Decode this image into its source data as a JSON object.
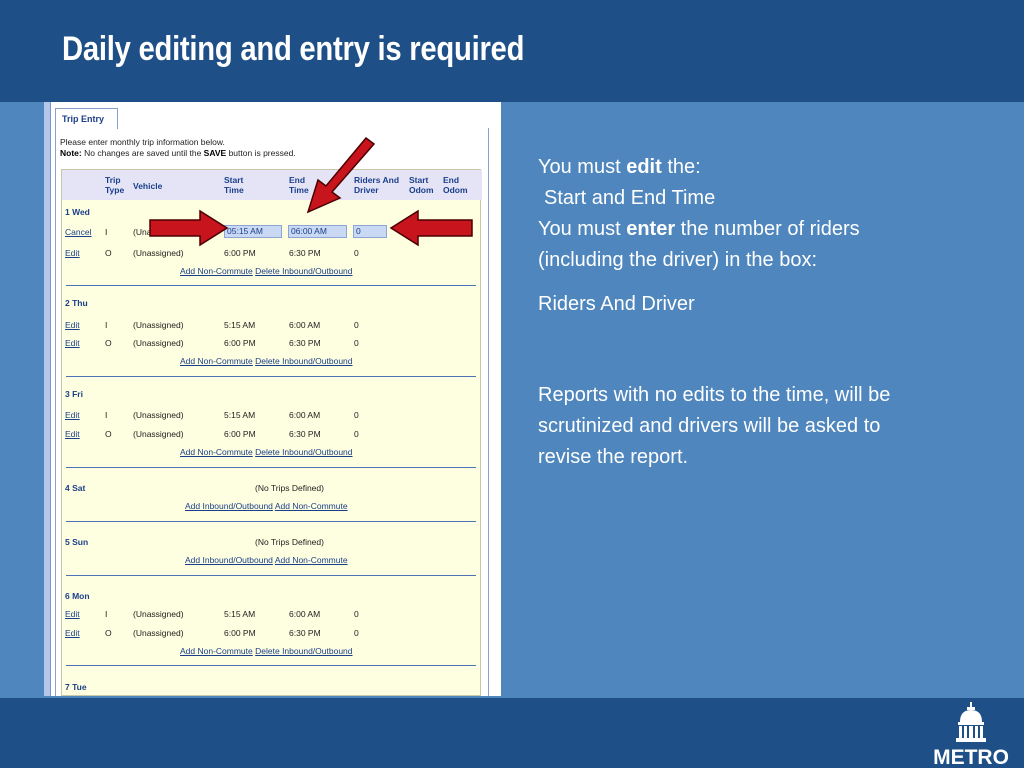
{
  "slide": {
    "title": "Daily editing and entry is required",
    "logo_text": "METRO"
  },
  "form": {
    "tab_label": "Trip Entry",
    "instruction": "Please enter monthly trip information below.",
    "note_label": "Note:",
    "note_text_1": "No changes are saved until the",
    "note_save": "SAVE",
    "note_text_2": "button is pressed.",
    "headers": {
      "trip_type_1": "Trip",
      "trip_type_2": "Type",
      "vehicle": "Vehicle",
      "start_time_1": "Start",
      "start_time_2": "Time",
      "end_time_1": "End",
      "end_time_2": "Time",
      "riders_1": "Riders And",
      "riders_2": "Driver",
      "start_odom_1": "Start",
      "start_odom_2": "Odom",
      "end_odom_1": "End",
      "end_odom_2": "Odom"
    },
    "days": {
      "wed": "1 Wed",
      "thu": "2 Thu",
      "fri": "3 Fri",
      "sat": "4 Sat",
      "sun": "5 Sun",
      "mon": "6 Mon",
      "tue": "7 Tue"
    },
    "links": {
      "cancel": "Cancel",
      "edit": "Edit",
      "add_non_commute": "Add Non-Commute",
      "delete_inbound_outbound": "Delete Inbound/Outbound",
      "add_inbound_outbound": "Add Inbound/Outbound"
    },
    "no_trips": "(No Trips Defined)",
    "values": {
      "type_in": "I",
      "type_out": "O",
      "vehicle": "(Unassigned)",
      "vehicle_cut": "(Una",
      "start_in": "5:15 AM",
      "end_in": "6:00 AM",
      "start_out": "6:00 PM",
      "end_out": "6:30 PM",
      "riders": "0"
    },
    "inputs": {
      "start_time": "05:15 AM",
      "end_time": "06:00 AM",
      "riders": "0"
    }
  },
  "notes": {
    "edit_prefix": "You must ",
    "edit_word": "edit",
    "edit_suffix": " the:",
    "edit_item": "Start and End Time",
    "enter_prefix": "You must ",
    "enter_word": "enter",
    "enter_suffix": " the number of riders (including the driver) in the box:",
    "enter_item": "Riders And Driver",
    "warning": "Reports with no edits to the time, will be scrutinized and drivers will be asked to revise the report."
  },
  "colors": {
    "header_bar": "#1e4f86",
    "background": "#4e86bd",
    "arrow": "#c8141c",
    "link": "#1b3f8a"
  }
}
